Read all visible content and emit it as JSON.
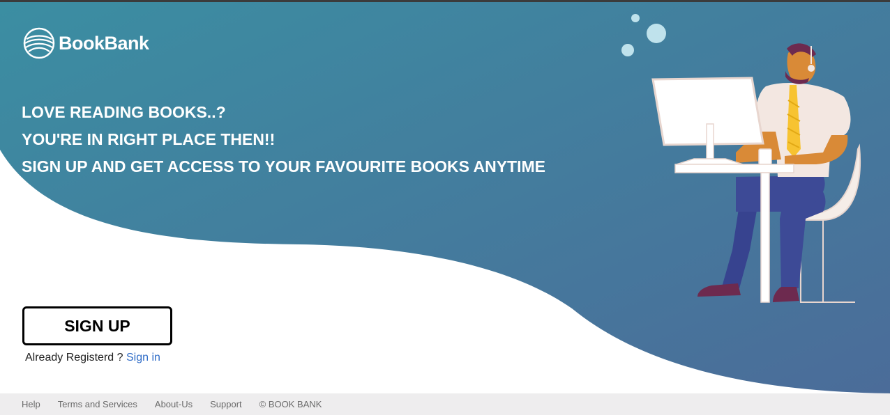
{
  "brand": {
    "name": "BookBank"
  },
  "headline": {
    "line1": "LOVE READING BOOKS..?",
    "line2": "YOU'RE IN RIGHT PLACE THEN!!",
    "line3": "SIGN UP AND GET ACCESS TO YOUR FAVOURITE BOOKS ANYTIME"
  },
  "cta": {
    "signup_label": "SIGN UP",
    "already_text": "Already Registerd ?",
    "signin_label": "Sign in"
  },
  "footer": {
    "links": [
      "Help",
      "Terms and Services",
      "About-Us",
      "Support"
    ],
    "copyright": "© BOOK BANK"
  },
  "colors": {
    "hero_gradient_start": "#3a8fa1",
    "hero_gradient_end": "#4b6c99",
    "link": "#2f6cc7",
    "footer_bg": "#eeedee"
  },
  "icons": [
    "bookbank-logo-icon",
    "person-at-computer-illustration"
  ]
}
